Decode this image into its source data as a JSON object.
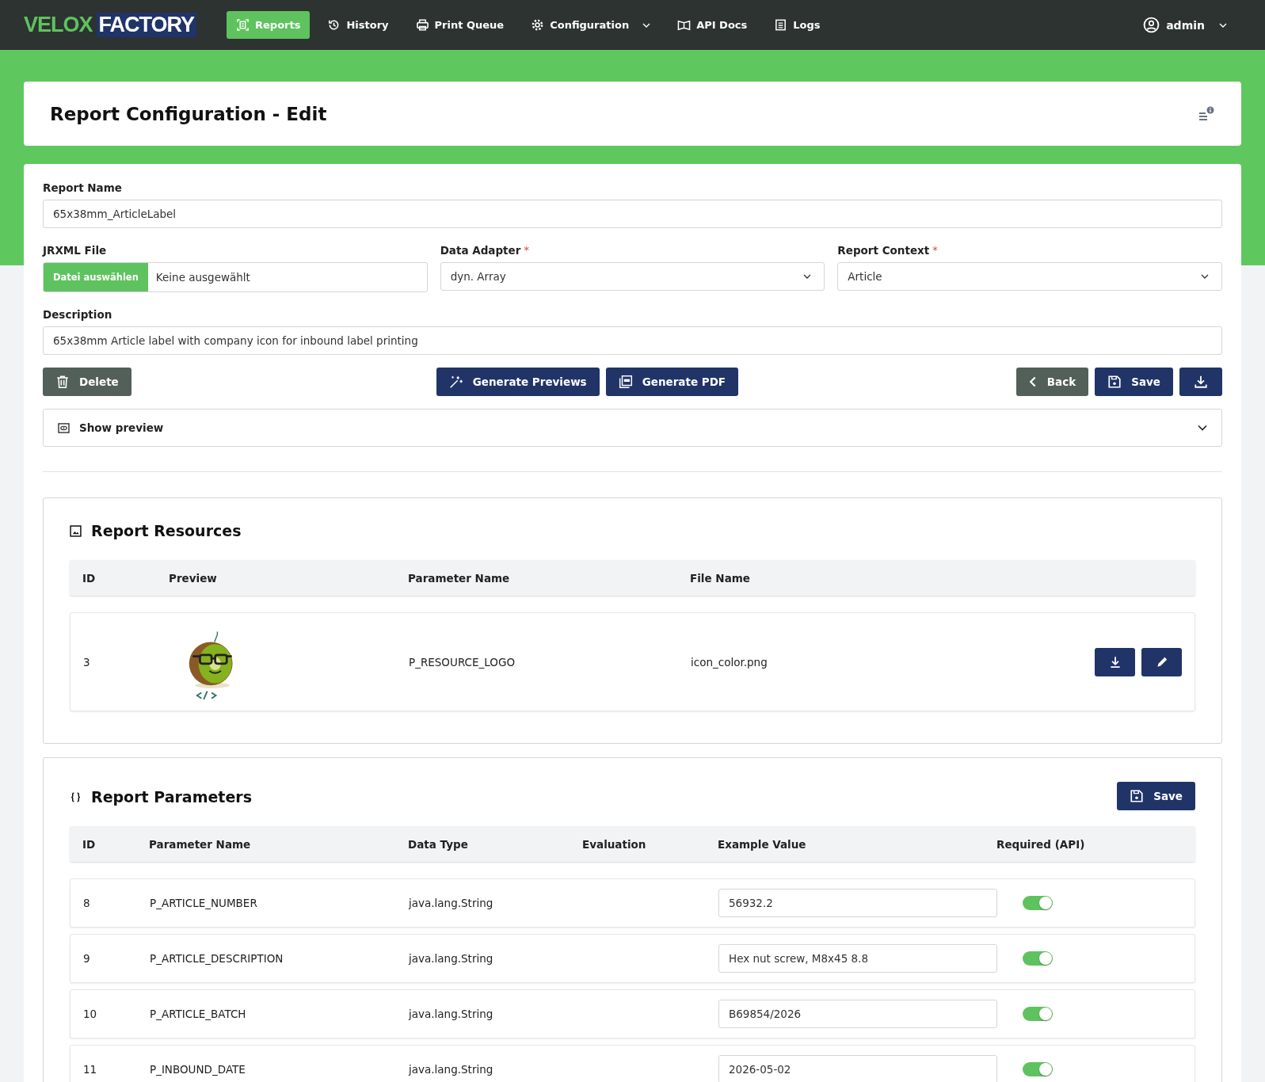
{
  "navbar": {
    "logo": {
      "left": "VELOX",
      "right": "FACTORY"
    },
    "items": [
      {
        "label": "Reports",
        "selected": true,
        "has_menu": false
      },
      {
        "label": "History",
        "selected": false,
        "has_menu": false
      },
      {
        "label": "Print Queue",
        "selected": false,
        "has_menu": false
      },
      {
        "label": "Configuration",
        "selected": false,
        "has_menu": true
      },
      {
        "label": "API Docs",
        "selected": false,
        "has_menu": false
      },
      {
        "label": "Logs",
        "selected": false,
        "has_menu": false
      }
    ],
    "user": {
      "label": "admin"
    }
  },
  "page_header": {
    "title": "Report Configuration - Edit"
  },
  "form": {
    "report_name": {
      "label": "Report Name",
      "value": "65x38mm_ArticleLabel"
    },
    "jrxml_file": {
      "label": "JRXML File",
      "button": "Datei auswählen",
      "value": "Keine ausgewählt"
    },
    "data_adapter": {
      "label": "Data Adapter",
      "required_mark": "*",
      "value": "dyn. Array"
    },
    "report_context": {
      "label": "Report Context",
      "required_mark": "*",
      "value": "Article"
    },
    "description": {
      "label": "Description",
      "value": "65x38mm Article label with company icon for inbound label printing"
    },
    "buttons": {
      "delete": "Delete",
      "generate_previews": "Generate Previews",
      "generate_pdf": "Generate PDF",
      "back": "Back",
      "save": "Save"
    },
    "preview_panel": {
      "label": "Show preview",
      "expanded": false
    }
  },
  "resources": {
    "title": "Report Resources",
    "columns": [
      "ID",
      "Preview",
      "Parameter Name",
      "File Name"
    ],
    "rows": [
      {
        "id": "3",
        "parameter_name": "P_RESOURCE_LOGO",
        "file_name": "icon_color.png"
      }
    ]
  },
  "parameters": {
    "title": "Report Parameters",
    "save": "Save",
    "columns": [
      "ID",
      "Parameter Name",
      "Data Type",
      "Evaluation",
      "Example Value",
      "Required (API)"
    ],
    "rows": [
      {
        "id": "8",
        "name": "P_ARTICLE_NUMBER",
        "data_type": "java.lang.String",
        "example": "56932.2",
        "required": true
      },
      {
        "id": "9",
        "name": "P_ARTICLE_DESCRIPTION",
        "data_type": "java.lang.String",
        "example": "Hex nut screw, M8x45 8.8",
        "required": true
      },
      {
        "id": "10",
        "name": "P_ARTICLE_BATCH",
        "data_type": "java.lang.String",
        "example": "B69854/2026",
        "required": true
      },
      {
        "id": "11",
        "name": "P_INBOUND_DATE",
        "data_type": "java.lang.String",
        "example": "2026-05-02",
        "required": true
      }
    ]
  }
}
